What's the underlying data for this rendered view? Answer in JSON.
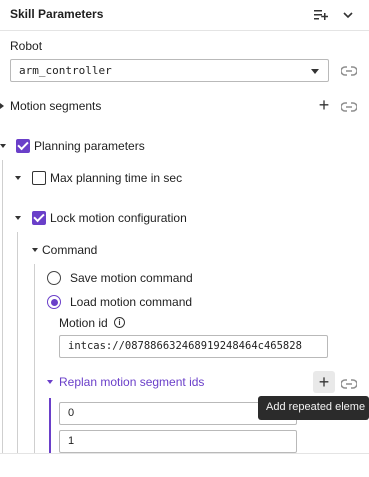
{
  "header": {
    "title": "Skill Parameters"
  },
  "robot": {
    "label": "Robot",
    "value": "arm_controller"
  },
  "motion_segments": {
    "label": "Motion segments"
  },
  "planning_parameters": {
    "label": "Planning parameters",
    "checked": true,
    "max_planning_time": {
      "label": "Max planning time in sec",
      "checked": false
    },
    "lock_motion_configuration": {
      "label": "Lock motion configuration",
      "checked": true,
      "command": {
        "label": "Command",
        "options": [
          {
            "label": "Save motion command",
            "selected": false
          },
          {
            "label": "Load motion command",
            "selected": true
          }
        ],
        "motion_id": {
          "label": "Motion id",
          "value": "intcas://087886632468919248464c465828"
        }
      },
      "replan": {
        "label": "Replan motion segment ids",
        "values": [
          "0",
          "1"
        ],
        "tooltip": "Add repeated eleme"
      }
    }
  },
  "colors": {
    "accent": "#6a3fc9",
    "tooltip_bg": "#2b2b2b"
  },
  "icons": {
    "header_add": "playlist-add-icon",
    "header_collapse": "chevron-down-icon",
    "link": "link-icon",
    "add": "plus-icon",
    "info": "info-icon"
  }
}
